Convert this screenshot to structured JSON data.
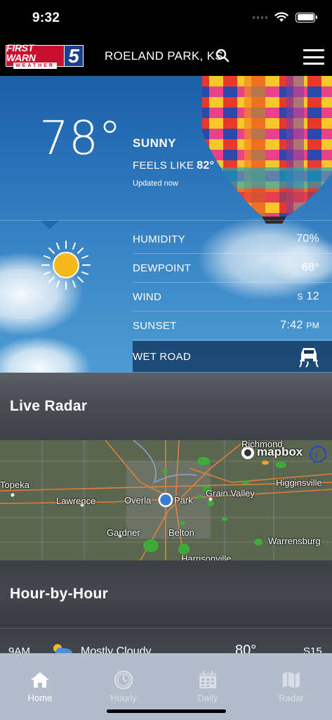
{
  "status": {
    "time": "9:32"
  },
  "header": {
    "logo_top": "FIRST WARN",
    "logo_bottom": "WEATHER",
    "logo_number": "5",
    "location": "ROELAND PARK, KS"
  },
  "current": {
    "temperature": "78°",
    "condition": "SUNNY",
    "feels_like_label": "FEELS LIKE",
    "feels_like_value": "82°",
    "updated": "Updated now"
  },
  "details": [
    {
      "label": "HUMIDITY",
      "value": "70%"
    },
    {
      "label": "DEWPOINT",
      "value": "68°"
    },
    {
      "label": "WIND",
      "value_dir": "S",
      "value": "12"
    },
    {
      "label": "SUNSET",
      "value": "7:42",
      "value_suffix": "PM"
    }
  ],
  "alert": {
    "label": "WET ROAD",
    "icon": "slippery-car-icon"
  },
  "radar": {
    "title": "Live Radar",
    "mapbox": "mapbox",
    "labels": [
      "Richmond",
      "Topeka",
      "Lawrence",
      "Overla",
      "Park",
      "Grain Valley",
      "Higginsville",
      "Gardner",
      "Belton",
      "Warrensburg",
      "Harrisonville"
    ]
  },
  "hourly": {
    "title": "Hour-by-Hour",
    "row": {
      "time": "9AM",
      "condition": "Mostly Cloudy",
      "temp": "80°",
      "wind": "S15",
      "icon": "cloud-sun-icon"
    }
  },
  "tabs": [
    {
      "label": "Home",
      "icon": "home-icon",
      "active": true
    },
    {
      "label": "Hourly",
      "icon": "clock-icon",
      "active": false
    },
    {
      "label": "Daily",
      "icon": "calendar-icon",
      "active": false
    },
    {
      "label": "Radar",
      "icon": "map-icon",
      "active": false
    }
  ],
  "colors": {
    "brand_red": "#c8102e",
    "brand_blue": "#1b3f8f",
    "sun": "#f5b91e",
    "tab_bar": "#b3bccb"
  }
}
